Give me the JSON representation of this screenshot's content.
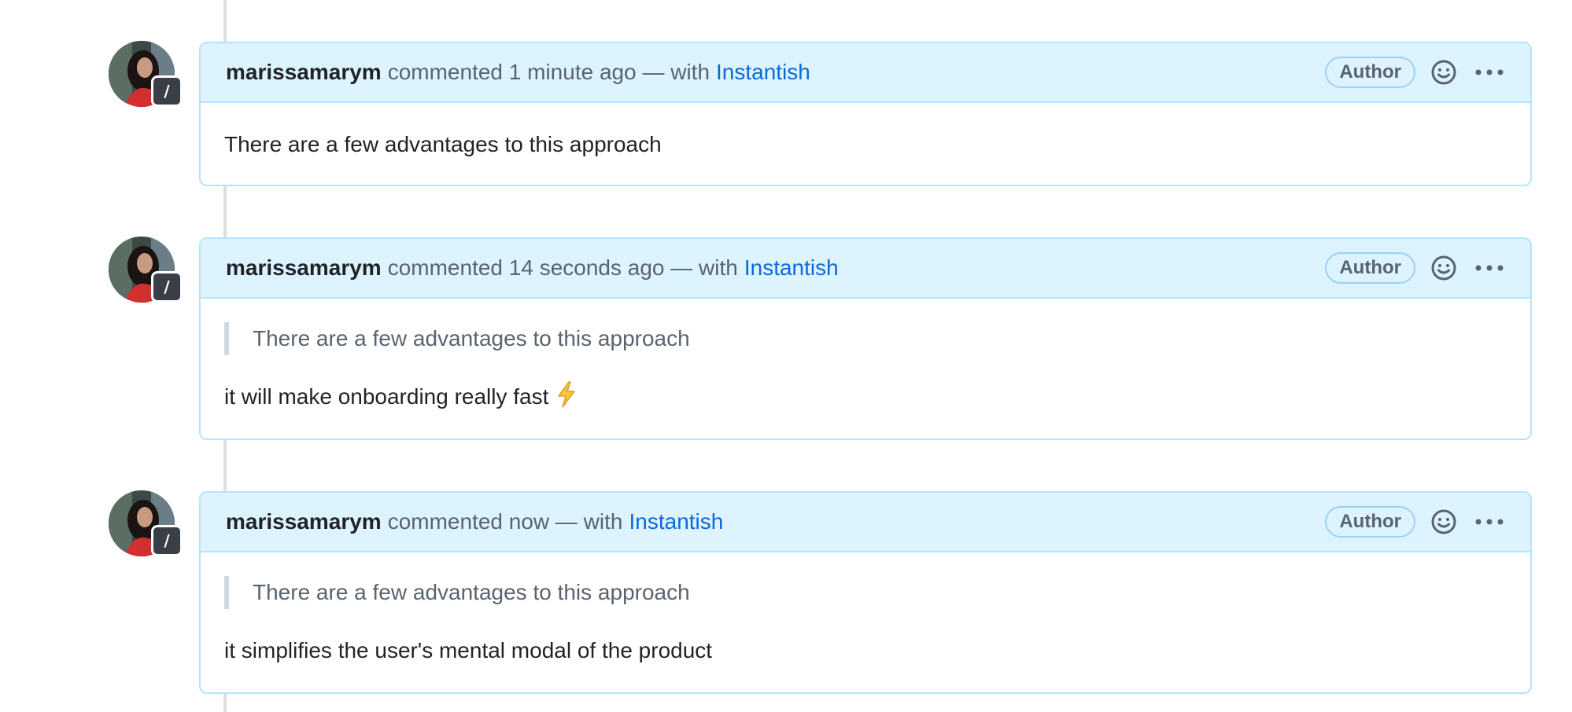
{
  "comments": [
    {
      "author": "marissamarym",
      "meta": "commented 1 minute ago — with",
      "via": "Instantish",
      "badge": "Author",
      "app_badge": "/",
      "quote": "",
      "body": "There are a few advantages to this approach",
      "emoji": ""
    },
    {
      "author": "marissamarym",
      "meta": "commented 14 seconds ago — with",
      "via": "Instantish",
      "badge": "Author",
      "app_badge": "/",
      "quote": "There are a few advantages to this approach",
      "body": "it will make onboarding really fast",
      "emoji": "lightning-bolt-icon"
    },
    {
      "author": "marissamarym",
      "meta": "commented now — with",
      "via": "Instantish",
      "badge": "Author",
      "app_badge": "/",
      "quote": "There are a few advantages to this approach",
      "body": "it simplifies the user's mental modal of the product",
      "emoji": ""
    }
  ],
  "icons": {
    "reaction": "smiley-face-icon",
    "more": "kebab-horizontal-icon"
  },
  "colors": {
    "header_bg": "#ddf4ff",
    "border": "#b6e3ff",
    "link": "#0969da",
    "muted": "#59636e",
    "timeline": "#d8dee4"
  }
}
